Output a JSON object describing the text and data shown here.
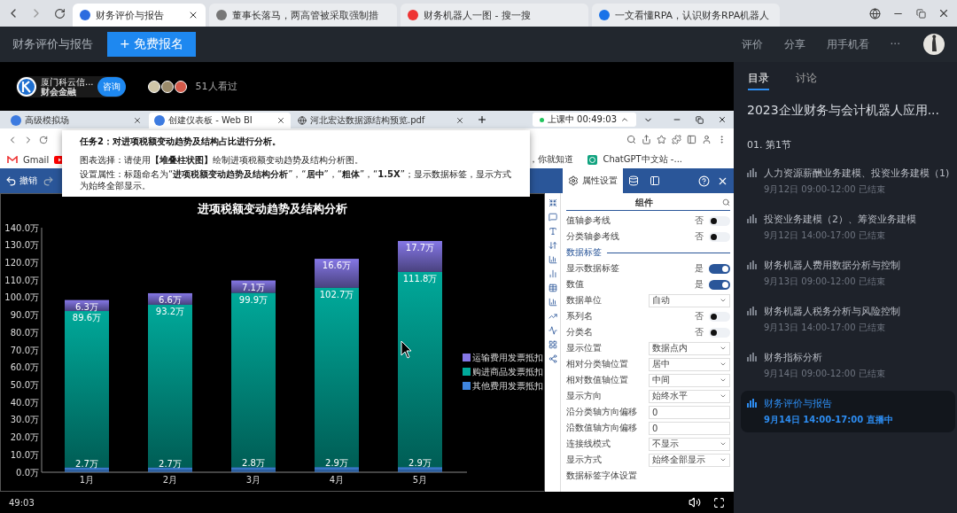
{
  "browser": {
    "tabs": [
      {
        "label": "财务评价与报告",
        "selected": true
      },
      {
        "label": "董事长落马，两高管被采取强制措",
        "selected": false
      },
      {
        "label": "财务机器人一图 - 搜一搜",
        "selected": false
      },
      {
        "label": "一文看懂RPA，认识财务RPA机器人",
        "selected": false
      }
    ]
  },
  "header": {
    "title": "财务评价与报告",
    "register_button": "+ 免费报名",
    "actions": [
      "评价",
      "分享",
      "用手机看",
      "···"
    ]
  },
  "host": {
    "name": "厦门科云信...",
    "tag": "财会金融",
    "consult_button": "咨询",
    "viewers": "51人看过"
  },
  "screen": {
    "tabs": [
      {
        "label": "高级模拟场",
        "selected": false
      },
      {
        "label": "创建仪表板 - Web BI",
        "selected": true
      },
      {
        "label": "河北宏达数据源结构预览.pdf",
        "selected": false
      }
    ],
    "live": "上课中 00:49:03",
    "bookmarks": [
      "Gmail",
      "，你就知道",
      "ChatGPT中文站 -..."
    ],
    "toolbar": {
      "undo": "撤销"
    },
    "task": {
      "heading": "任务2：对进项税额变动趋势及结构占比进行分析。",
      "lines": [
        "图表选择：请使用**【堆叠柱状图】**绘制进项税额变动趋势及结构分析图。",
        "设置属性：标题命名为“**进项税额变动趋势及结构分析**”，“**居中**”，“**粗体**”，“**1.5X**”；显示数据标签，显示方式为始终全部显示。"
      ]
    },
    "chart_data": {
      "type": "bar",
      "title": "进项税额变动趋势及结构分析",
      "categories": [
        "1月",
        "2月",
        "3月",
        "4月",
        "5月"
      ],
      "stacked": true,
      "ylim": [
        0,
        140
      ],
      "yticks": [
        {
          "value": 0,
          "label": "0.0万"
        },
        {
          "value": 10,
          "label": "10.0万"
        },
        {
          "value": 20,
          "label": "20.0万"
        },
        {
          "value": 30,
          "label": "30.0万"
        },
        {
          "value": 40,
          "label": "40.0万"
        },
        {
          "value": 50,
          "label": "50.0万"
        },
        {
          "value": 60,
          "label": "60.0万"
        },
        {
          "value": 70,
          "label": "70.0万"
        },
        {
          "value": 80,
          "label": "80.0万"
        },
        {
          "value": 90,
          "label": "90.0万"
        },
        {
          "value": 100,
          "label": "100.0万"
        },
        {
          "value": 110,
          "label": "110.0万"
        },
        {
          "value": 120,
          "label": "120.0万"
        },
        {
          "value": 130,
          "label": "130.0万"
        },
        {
          "value": 140,
          "label": "140.0万"
        }
      ],
      "legend": "right",
      "series": [
        {
          "name": "其他费用发票抵扣",
          "color": "#3f86e0",
          "values": [
            2.7,
            2.7,
            2.8,
            2.9,
            2.9
          ]
        },
        {
          "name": "购进商品发票抵扣",
          "color": "#00a99a",
          "values": [
            89.6,
            93.2,
            99.9,
            102.7,
            111.8
          ]
        },
        {
          "name": "运输费用发票抵扣",
          "color": "#8577e6",
          "values": [
            6.3,
            6.6,
            7.1,
            16.6,
            17.7
          ]
        }
      ],
      "value_labels": [
        [
          "2.7万",
          "2.7万",
          "2.8万",
          "2.9万",
          "2.9万"
        ],
        [
          "89.6万",
          "93.2万",
          "99.9万",
          "102.7万",
          "111.8万"
        ],
        [
          "6.3万",
          "6.6万",
          "7.1万",
          "16.6万",
          "17.7万"
        ]
      ]
    },
    "panel": {
      "tabs": [
        {
          "kind": "settings",
          "label": "属性设置",
          "selected": true
        },
        {
          "kind": "data",
          "selected": false
        },
        {
          "kind": "layout",
          "selected": false
        }
      ],
      "heading": "组件",
      "rows": [
        {
          "kind": "toggle",
          "label": "值轴参考线",
          "value": "否",
          "on": false
        },
        {
          "kind": "toggle",
          "label": "分类轴参考线",
          "value": "否",
          "on": false
        },
        {
          "kind": "section",
          "label": "数据标签"
        },
        {
          "kind": "toggle",
          "label": "显示数据标签",
          "value": "是",
          "on": true
        },
        {
          "kind": "toggle",
          "label": "数值",
          "value": "是",
          "on": true
        },
        {
          "kind": "select",
          "label": "数据单位",
          "value": "自动"
        },
        {
          "kind": "toggle",
          "label": "系列名",
          "value": "否",
          "on": false
        },
        {
          "kind": "toggle",
          "label": "分类名",
          "value": "否",
          "on": false
        },
        {
          "kind": "select",
          "label": "显示位置",
          "value": "数据点内"
        },
        {
          "kind": "select",
          "label": "相对分类轴位置",
          "value": "居中"
        },
        {
          "kind": "select",
          "label": "相对数值轴位置",
          "value": "中间"
        },
        {
          "kind": "select",
          "label": "显示方向",
          "value": "始终水平"
        },
        {
          "kind": "input",
          "label": "沿分类轴方向偏移",
          "value": "0"
        },
        {
          "kind": "input",
          "label": "沿数值轴方向偏移",
          "value": "0"
        },
        {
          "kind": "select",
          "label": "连接线模式",
          "value": "不显示"
        },
        {
          "kind": "select",
          "label": "显示方式",
          "value": "始终全部显示"
        },
        {
          "kind": "heading",
          "label": "数据标签字体设置"
        }
      ]
    }
  },
  "player": {
    "time": "49:03"
  },
  "sidebar": {
    "tabs": [
      {
        "label": "目录",
        "selected": true
      },
      {
        "label": "讨论",
        "selected": false
      }
    ],
    "course": "2023企业财务与会计机器人应用...",
    "section": "01. 第1节",
    "lessons": [
      {
        "title": "人力资源薪酬业务建模、投资业务建模（1)",
        "meta": "9月12日 09:00-12:00 已结束",
        "selected": false
      },
      {
        "title": "投资业务建模（2）、筹资业务建模",
        "meta": "9月12日 14:00-17:00 已结束",
        "selected": false
      },
      {
        "title": "财务机器人费用数据分析与控制",
        "meta": "9月13日 09:00-12:00 已结束",
        "selected": false
      },
      {
        "title": "财务机器人税务分析与风险控制",
        "meta": "9月13日 14:00-17:00 已结束",
        "selected": false
      },
      {
        "title": "财务指标分析",
        "meta": "9月14日 09:00-12:00 已结束",
        "selected": false
      },
      {
        "title": "财务评价与报告",
        "meta": "9月14日 14:00-17:00 直播中",
        "selected": true
      }
    ]
  }
}
